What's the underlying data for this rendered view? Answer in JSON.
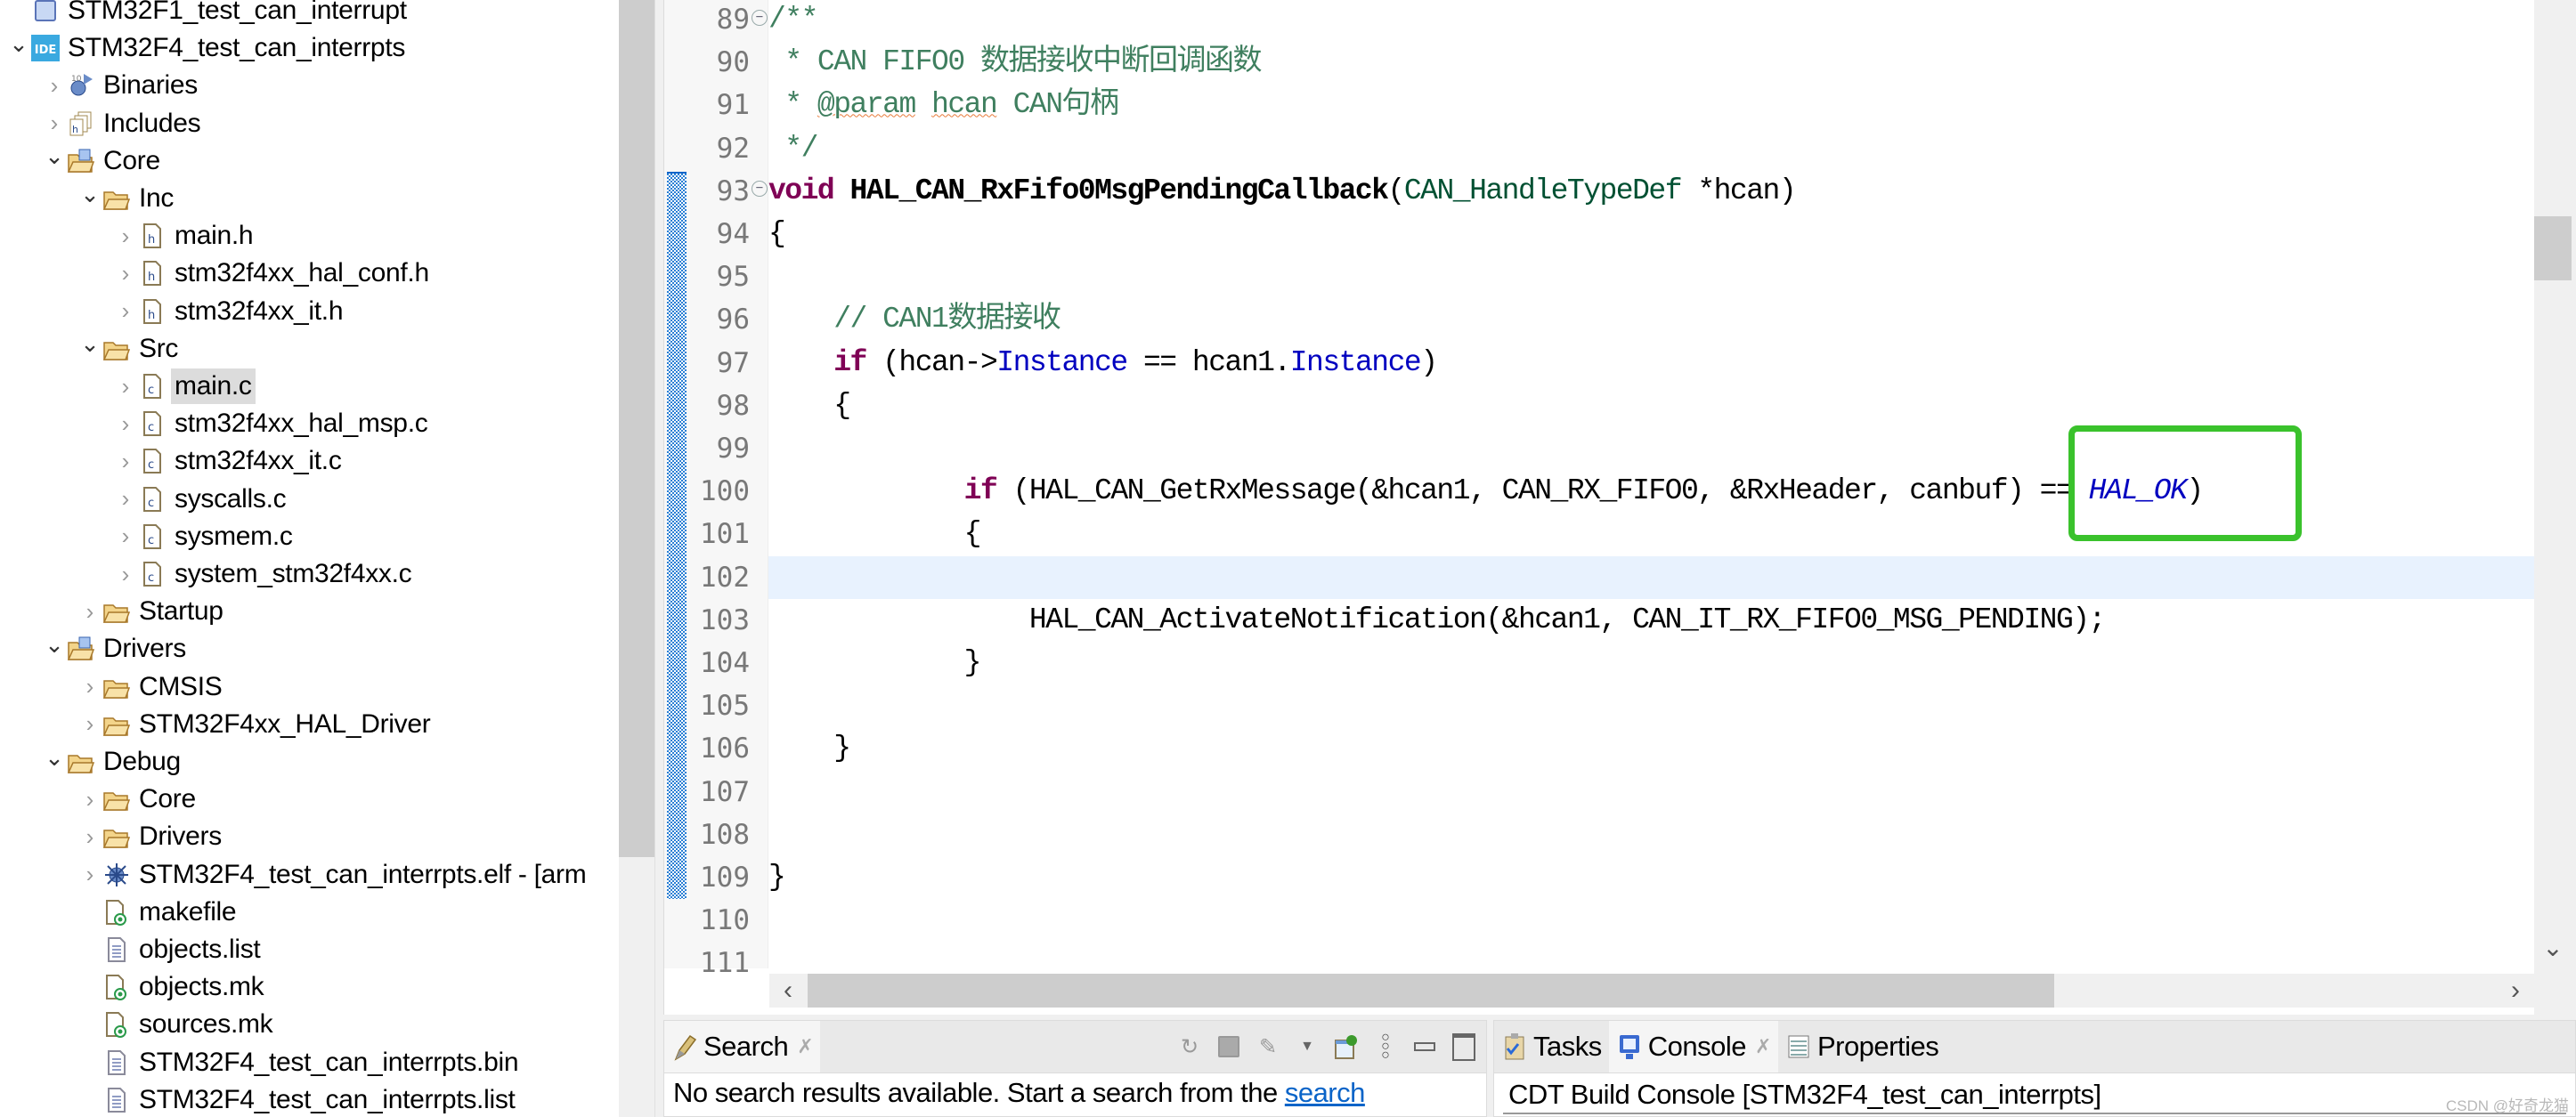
{
  "explorer": {
    "rows": [
      {
        "label": "STM32F1_test_can_interrupt",
        "depth": 0,
        "twisty": "none",
        "icon": "project-closed-icon"
      },
      {
        "label": "STM32F4_test_can_interrpts",
        "depth": 0,
        "twisty": "open",
        "icon": "ide-project-icon"
      },
      {
        "label": "Binaries",
        "depth": 1,
        "twisty": "closed",
        "icon": "binaries-icon"
      },
      {
        "label": "Includes",
        "depth": 1,
        "twisty": "closed",
        "icon": "includes-icon"
      },
      {
        "label": "Core",
        "depth": 1,
        "twisty": "open",
        "icon": "source-folder-icon"
      },
      {
        "label": "Inc",
        "depth": 2,
        "twisty": "open",
        "icon": "folder-icon"
      },
      {
        "label": "main.h",
        "depth": 3,
        "twisty": "closed",
        "icon": "header-file-icon"
      },
      {
        "label": "stm32f4xx_hal_conf.h",
        "depth": 3,
        "twisty": "closed",
        "icon": "header-file-icon"
      },
      {
        "label": "stm32f4xx_it.h",
        "depth": 3,
        "twisty": "closed",
        "icon": "header-file-icon"
      },
      {
        "label": "Src",
        "depth": 2,
        "twisty": "open",
        "icon": "folder-icon"
      },
      {
        "label": "main.c",
        "depth": 3,
        "twisty": "closed",
        "icon": "c-file-icon",
        "selected": true
      },
      {
        "label": "stm32f4xx_hal_msp.c",
        "depth": 3,
        "twisty": "closed",
        "icon": "c-file-icon"
      },
      {
        "label": "stm32f4xx_it.c",
        "depth": 3,
        "twisty": "closed",
        "icon": "c-file-icon"
      },
      {
        "label": "syscalls.c",
        "depth": 3,
        "twisty": "closed",
        "icon": "c-file-icon"
      },
      {
        "label": "sysmem.c",
        "depth": 3,
        "twisty": "closed",
        "icon": "c-file-icon"
      },
      {
        "label": "system_stm32f4xx.c",
        "depth": 3,
        "twisty": "closed",
        "icon": "c-file-icon"
      },
      {
        "label": "Startup",
        "depth": 2,
        "twisty": "closed",
        "icon": "folder-icon"
      },
      {
        "label": "Drivers",
        "depth": 1,
        "twisty": "open",
        "icon": "source-folder-icon"
      },
      {
        "label": "CMSIS",
        "depth": 2,
        "twisty": "closed",
        "icon": "folder-icon"
      },
      {
        "label": "STM32F4xx_HAL_Driver",
        "depth": 2,
        "twisty": "closed",
        "icon": "folder-icon"
      },
      {
        "label": "Debug",
        "depth": 1,
        "twisty": "open",
        "icon": "folder-icon"
      },
      {
        "label": "Core",
        "depth": 2,
        "twisty": "closed",
        "icon": "folder-icon"
      },
      {
        "label": "Drivers",
        "depth": 2,
        "twisty": "closed",
        "icon": "folder-icon"
      },
      {
        "label": "STM32F4_test_can_interrpts.elf - [arm",
        "depth": 2,
        "twisty": "closed",
        "icon": "elf-binary-icon"
      },
      {
        "label": "makefile",
        "depth": 2,
        "twisty": "none",
        "icon": "makefile-icon"
      },
      {
        "label": "objects.list",
        "depth": 2,
        "twisty": "none",
        "icon": "text-file-icon"
      },
      {
        "label": "objects.mk",
        "depth": 2,
        "twisty": "none",
        "icon": "makefile-icon"
      },
      {
        "label": "sources.mk",
        "depth": 2,
        "twisty": "none",
        "icon": "makefile-icon"
      },
      {
        "label": "STM32F4_test_can_interrpts.bin",
        "depth": 2,
        "twisty": "none",
        "icon": "text-file-icon"
      },
      {
        "label": "STM32F4_test_can_interrpts.list",
        "depth": 2,
        "twisty": "none",
        "icon": "text-file-icon"
      }
    ]
  },
  "editor": {
    "current_line": 102,
    "change_ranges": [
      [
        93,
        109
      ]
    ],
    "fold_lines": [
      89,
      93
    ],
    "lines": [
      {
        "n": "89",
        "tokens": [
          {
            "t": "/**",
            "c": "cm"
          }
        ]
      },
      {
        "n": "90",
        "tokens": [
          {
            "t": " * CAN FIFO0 数据接收中断回调函数",
            "c": "cm"
          }
        ]
      },
      {
        "n": "91",
        "tokens": [
          {
            "t": " * ",
            "c": "cm"
          },
          {
            "t": "@param",
            "c": "cm-tag"
          },
          {
            "t": " ",
            "c": "cm"
          },
          {
            "t": "hcan",
            "c": "cm-tag"
          },
          {
            "t": " CAN句柄",
            "c": "cm"
          }
        ]
      },
      {
        "n": "92",
        "tokens": [
          {
            "t": " */",
            "c": "cm"
          }
        ]
      },
      {
        "n": "93",
        "tokens": [
          {
            "t": "void",
            "c": "kw"
          },
          {
            "t": " ",
            "c": ""
          },
          {
            "t": "HAL_CAN_RxFifo0MsgPendingCallback",
            "c": "fn"
          },
          {
            "t": "(",
            "c": ""
          },
          {
            "t": "CAN_HandleTypeDef",
            "c": "ty"
          },
          {
            "t": " *hcan)",
            "c": ""
          }
        ]
      },
      {
        "n": "94",
        "tokens": [
          {
            "t": "{",
            "c": ""
          }
        ]
      },
      {
        "n": "95",
        "tokens": []
      },
      {
        "n": "96",
        "tokens": [
          {
            "t": "    ",
            "c": ""
          },
          {
            "t": "// CAN1数据接收",
            "c": "cm"
          }
        ]
      },
      {
        "n": "97",
        "tokens": [
          {
            "t": "    ",
            "c": ""
          },
          {
            "t": "if",
            "c": "kw"
          },
          {
            "t": " (hcan->",
            "c": ""
          },
          {
            "t": "Instance",
            "c": "fld"
          },
          {
            "t": " == hcan1.",
            "c": ""
          },
          {
            "t": "Instance",
            "c": "fld"
          },
          {
            "t": ")",
            "c": ""
          }
        ]
      },
      {
        "n": "98",
        "tokens": [
          {
            "t": "    {",
            "c": ""
          }
        ]
      },
      {
        "n": "99",
        "tokens": []
      },
      {
        "n": "100",
        "tokens": [
          {
            "t": "            ",
            "c": ""
          },
          {
            "t": "if",
            "c": "kw"
          },
          {
            "t": " (HAL_CAN_GetRxMessage(&hcan1, CAN_RX_FIFO0, &RxHeader, canbuf) == ",
            "c": ""
          },
          {
            "t": "HAL_OK",
            "c": "enm"
          },
          {
            "t": ")",
            "c": ""
          }
        ]
      },
      {
        "n": "101",
        "tokens": [
          {
            "t": "            {",
            "c": ""
          }
        ]
      },
      {
        "n": "102",
        "tokens": []
      },
      {
        "n": "103",
        "tokens": [
          {
            "t": "                HAL_CAN_ActivateNotification(&hcan1, CAN_IT_RX_FIFO0_MSG_PENDING);",
            "c": ""
          }
        ]
      },
      {
        "n": "104",
        "tokens": [
          {
            "t": "            }",
            "c": ""
          }
        ]
      },
      {
        "n": "105",
        "tokens": []
      },
      {
        "n": "106",
        "tokens": [
          {
            "t": "    }",
            "c": ""
          }
        ]
      },
      {
        "n": "107",
        "tokens": []
      },
      {
        "n": "108",
        "tokens": []
      },
      {
        "n": "109",
        "tokens": [
          {
            "t": "}",
            "c": ""
          }
        ]
      },
      {
        "n": "110",
        "tokens": []
      },
      {
        "n": "111",
        "tokens": []
      }
    ],
    "annotation_box_color": "#3ac22c"
  },
  "search_panel": {
    "tab_label": "Search",
    "message": "No search results available. Start a search from the ",
    "link_text": "search",
    "toolbar": [
      "refresh-icon",
      "stop-icon",
      "search-history-icon",
      "dropdown-icon",
      "pin-icon",
      "view-menu-icon",
      "minimize-icon",
      "maximize-icon"
    ]
  },
  "console_panel": {
    "tabs": [
      {
        "label": "Tasks",
        "icon": "tasks-icon",
        "active": false,
        "closable": false
      },
      {
        "label": "Console",
        "icon": "console-icon",
        "active": true,
        "closable": true
      },
      {
        "label": "Properties",
        "icon": "properties-icon",
        "active": false,
        "closable": false
      }
    ],
    "title": "CDT Build Console [STM32F4_test_can_interrpts]"
  },
  "watermark": "CSDN @好奇龙猫"
}
